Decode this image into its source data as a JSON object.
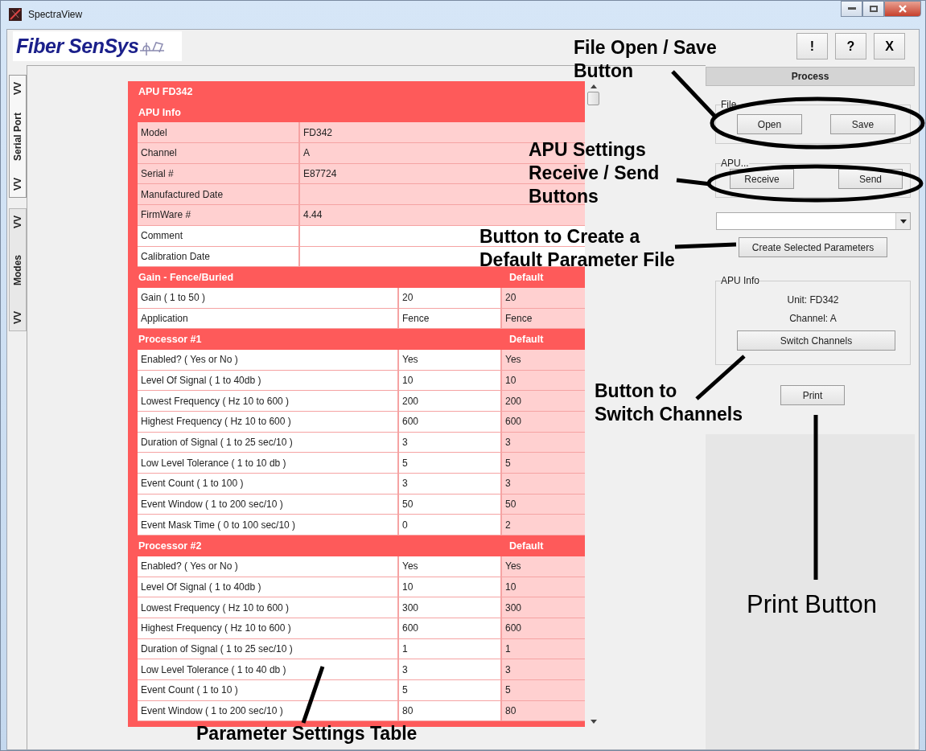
{
  "window": {
    "title": "SpectraView"
  },
  "logo": "Fiber SenSys",
  "header_buttons": [
    "!",
    "?",
    "X"
  ],
  "side_tabs": [
    {
      "lead": "VV",
      "label": "Serial Port",
      "trail": "VV",
      "selected": true
    },
    {
      "lead": "VV",
      "label": "Modes",
      "trail": "VV",
      "selected": false
    }
  ],
  "table": {
    "title": "APU FD342",
    "info_heading": "APU Info",
    "info_rows": [
      {
        "label": "Model",
        "value": "FD342",
        "read_only": true
      },
      {
        "label": "Channel",
        "value": "A",
        "read_only": true
      },
      {
        "label": "Serial #",
        "value": "E87724",
        "read_only": true
      },
      {
        "label": "Manufactured Date",
        "read_only": true
      },
      {
        "label": "FirmWare #",
        "value": "4.44",
        "read_only": true
      },
      {
        "label": "Comment",
        "read_only": false
      },
      {
        "label": "Calibration Date",
        "read_only": false
      }
    ],
    "sections": [
      {
        "title": "Gain - Fence/Buried",
        "default_heading": "Default",
        "rows": [
          {
            "label": "Gain ( 1 to 50 )",
            "value": "20",
            "default": "20"
          },
          {
            "label": "Application",
            "value": "Fence",
            "default": "Fence"
          }
        ]
      },
      {
        "title": "Processor #1",
        "default_heading": "Default",
        "rows": [
          {
            "label": "Enabled? ( Yes or No )",
            "value": "Yes",
            "default": "Yes"
          },
          {
            "label": "Level Of Signal ( 1 to 40db )",
            "value": "10",
            "default": "10"
          },
          {
            "label": "Lowest Frequency ( Hz 10 to 600 )",
            "value": "200",
            "default": "200"
          },
          {
            "label": "Highest Frequency ( Hz 10 to 600 )",
            "value": "600",
            "default": "600"
          },
          {
            "label": "Duration of Signal ( 1 to 25 sec/10 )",
            "value": "3",
            "default": "3"
          },
          {
            "label": "Low Level Tolerance ( 1 to 10 db )",
            "value": "5",
            "default": "5"
          },
          {
            "label": "Event Count ( 1 to 100 )",
            "value": "3",
            "default": "3"
          },
          {
            "label": "Event Window ( 1 to 200 sec/10 )",
            "value": "50",
            "default": "50"
          },
          {
            "label": "Event Mask Time ( 0 to 100 sec/10 )",
            "value": "0",
            "default": "2"
          }
        ]
      },
      {
        "title": "Processor #2",
        "default_heading": "Default",
        "rows": [
          {
            "label": "Enabled? ( Yes or No )",
            "value": "Yes",
            "default": "Yes"
          },
          {
            "label": "Level Of Signal ( 1 to 40db )",
            "value": "10",
            "default": "10"
          },
          {
            "label": "Lowest Frequency ( Hz 10 to 600 )",
            "value": "300",
            "default": "300"
          },
          {
            "label": "Highest Frequency ( Hz 10 to 600 )",
            "value": "600",
            "default": "600"
          },
          {
            "label": "Duration of Signal ( 1 to 25 sec/10 )",
            "value": "1",
            "default": "1"
          },
          {
            "label": "Low Level Tolerance ( 1 to 40 db )",
            "value": "3",
            "default": "3"
          },
          {
            "label": "Event Count ( 1 to 10 )",
            "value": "5",
            "default": "5"
          },
          {
            "label": "Event Window ( 1 to 200 sec/10 )",
            "value": "80",
            "default": "80"
          }
        ]
      }
    ]
  },
  "process_panel": {
    "title": "Process",
    "file_group": {
      "legend": "File",
      "buttons": [
        "Open",
        "Save"
      ]
    },
    "apu_group": {
      "legend": "APU...",
      "buttons": [
        "Receive",
        "Send"
      ]
    },
    "create_button": "Create Selected Parameters",
    "info_group": {
      "legend": "APU Info",
      "unit": "Unit: FD342",
      "channel": "Channel: A",
      "button": "Switch Channels"
    },
    "print_button": "Print"
  },
  "annotations": [
    {
      "kind": "bold",
      "text": "File Open / Save\nButton"
    },
    {
      "kind": "bold",
      "text": "APU Settings\nReceive / Send\nButtons"
    },
    {
      "kind": "bold",
      "text": "Button to Create a\nDefault Parameter File"
    },
    {
      "kind": "bold",
      "text": "Button to\nSwitch Channels"
    },
    {
      "kind": "plain",
      "text": "Print Button"
    },
    {
      "kind": "bold",
      "text": "Parameter Settings Table"
    }
  ]
}
